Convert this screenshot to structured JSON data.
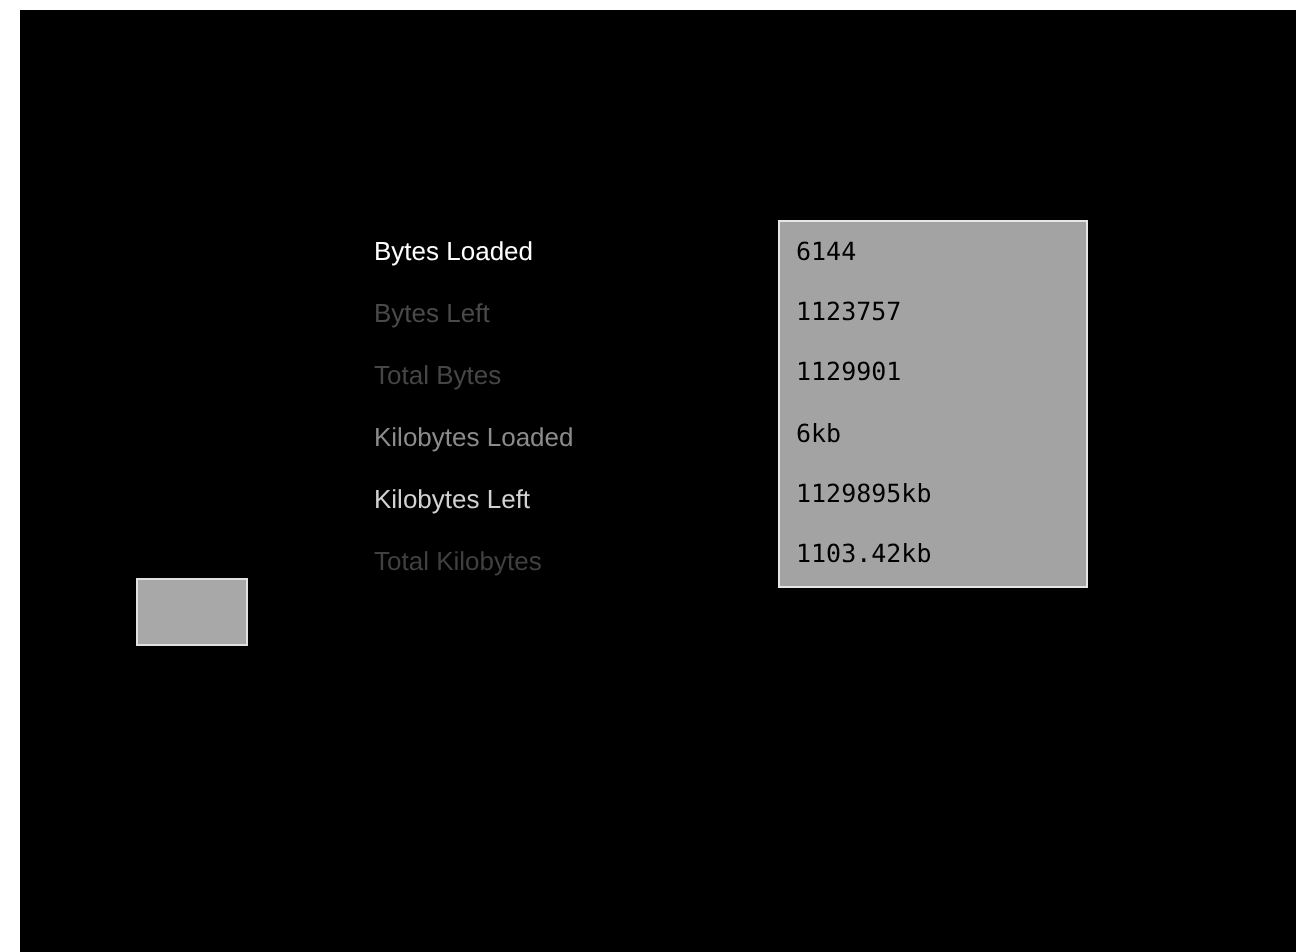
{
  "stats": [
    {
      "label": "Bytes Loaded",
      "color": "#ffffff",
      "value": "6144"
    },
    {
      "label": "Bytes Left",
      "color": "#4a4a4a",
      "value": "1123757"
    },
    {
      "label": "Total Bytes",
      "color": "#464646",
      "value": "1129901"
    },
    {
      "label": "Kilobytes Loaded",
      "color": "#8c8c8c",
      "value": "6kb"
    },
    {
      "label": "Kilobytes Left",
      "color": "#d2d2d2",
      "value": "1129895kb"
    },
    {
      "label": "Total Kilobytes",
      "color": "#404040",
      "value": "1103.42kb"
    }
  ]
}
